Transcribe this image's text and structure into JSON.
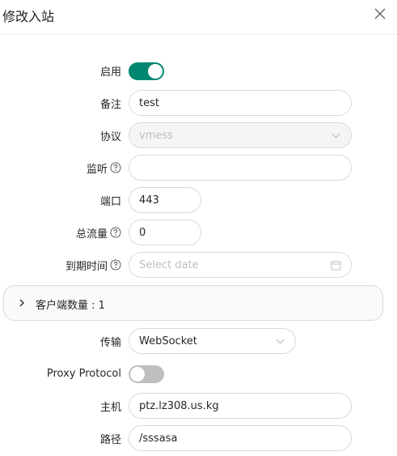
{
  "dialog": {
    "title": "修改入站"
  },
  "form": {
    "enable": {
      "label": "启用",
      "value": true
    },
    "remark": {
      "label": "备注",
      "value": "test"
    },
    "protocol": {
      "label": "协议",
      "value": "vmess"
    },
    "listen": {
      "label": "监听",
      "value": ""
    },
    "port": {
      "label": "端口",
      "value": "443"
    },
    "total_traffic": {
      "label": "总流量",
      "value": "0"
    },
    "expiry_time": {
      "label": "到期时间",
      "placeholder": "Select date"
    },
    "clients": {
      "label": "客户端数量 : 1"
    },
    "transport": {
      "label": "传输",
      "value": "WebSocket"
    },
    "proxy_protocol": {
      "label": "Proxy Protocol",
      "value": false
    },
    "host": {
      "label": "主机",
      "value": "ptz.lz308.us.kg"
    },
    "path": {
      "label": "路径",
      "value": "/sssasa"
    }
  },
  "colors": {
    "accent": "#008771",
    "switch_off": "#bfbfbf",
    "border": "#d9d9d9"
  },
  "icons": {
    "close": "close-icon",
    "help": "question-circle-icon",
    "dropdown": "chevron-down-icon",
    "calendar": "calendar-icon",
    "expand": "chevron-right-icon"
  }
}
